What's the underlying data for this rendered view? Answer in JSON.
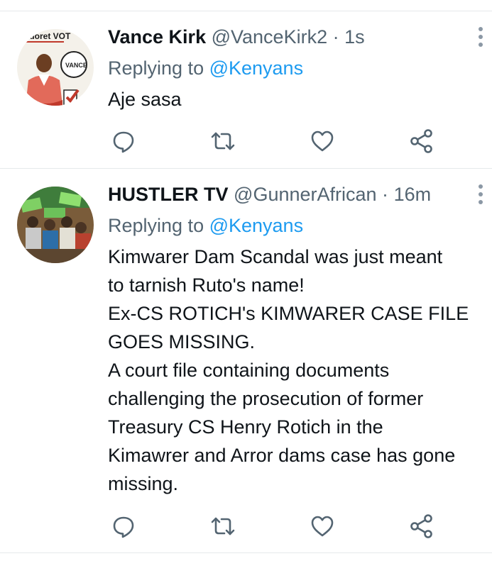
{
  "colors": {
    "text": "#0f1419",
    "secondary": "#536471",
    "link": "#1d9bf0",
    "divider": "#e6e9eb",
    "icon": "#536471"
  },
  "tweets": [
    {
      "name": "Vance Kirk",
      "handle": "@VanceKirk2",
      "separator": "·",
      "time": "1s",
      "reply_prefix": "Replying to ",
      "reply_to": "@Kenyans",
      "lines": [
        "Aje sasa"
      ],
      "avatar_caption": "Eldoret VOTE VANCE",
      "actions": [
        "reply-icon",
        "retweet-icon",
        "like-icon",
        "share-icon"
      ]
    },
    {
      "name": "HUSTLER TV",
      "handle": "@GunnerAfrican",
      "separator": "·",
      "time": "16m",
      "reply_prefix": "Replying to ",
      "reply_to": "@Kenyans",
      "lines": [
        "Kimwarer Dam Scandal was just meant",
        "to tarnish Ruto's name!",
        "Ex-CS ROTICH's KIMWARER CASE FILE",
        "GOES MISSING.",
        "A court file containing documents",
        "challenging the prosecution of former",
        "Treasury CS Henry Rotich in the",
        "Kimawrer and Arror dams case has gone",
        "missing."
      ],
      "actions": [
        "reply-icon",
        "retweet-icon",
        "like-icon",
        "share-icon"
      ]
    }
  ]
}
